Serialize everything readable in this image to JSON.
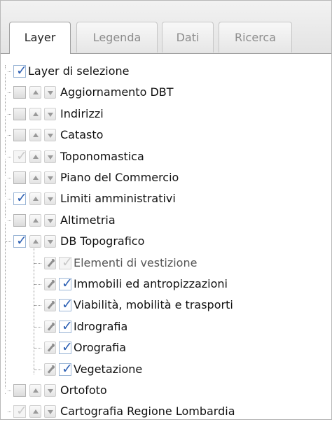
{
  "tabs": [
    {
      "label": "Layer",
      "active": true
    },
    {
      "label": "Legenda",
      "active": false
    },
    {
      "label": "Dati",
      "active": false
    },
    {
      "label": "Ricerca",
      "active": false
    }
  ],
  "layers": [
    {
      "label": "Layer di selezione",
      "checked": true
    },
    {
      "label": "Aggiornamento DBT",
      "checked": false
    },
    {
      "label": "Indirizzi",
      "checked": false
    },
    {
      "label": "Catasto",
      "checked": false
    },
    {
      "label": "Toponomastica",
      "checked": true,
      "disabled": true
    },
    {
      "label": "Piano del Commercio",
      "checked": false
    },
    {
      "label": "Limiti amministrativi",
      "checked": true
    },
    {
      "label": "Altimetria",
      "checked": false
    },
    {
      "label": "DB Topografico",
      "checked": true,
      "expanded": true
    }
  ],
  "sublayers": [
    {
      "label": "Elementi di vestizione",
      "checked": true,
      "disabled": true
    },
    {
      "label": "Immobili ed antropizzazioni",
      "checked": true
    },
    {
      "label": "Viabilità, mobilità e trasporti",
      "checked": true
    },
    {
      "label": "Idrografia",
      "checked": true
    },
    {
      "label": "Orografia",
      "checked": true
    },
    {
      "label": "Vegetazione",
      "checked": true
    }
  ],
  "bottom_layers": [
    {
      "label": "Ortofoto",
      "checked": false
    },
    {
      "label": "Cartografia Regione Lombardia",
      "checked": true,
      "disabled": true
    }
  ],
  "icons": {
    "check": "✓",
    "up": "arrow-up-icon",
    "down": "arrow-down-icon",
    "wrench": "wrench-icon"
  }
}
